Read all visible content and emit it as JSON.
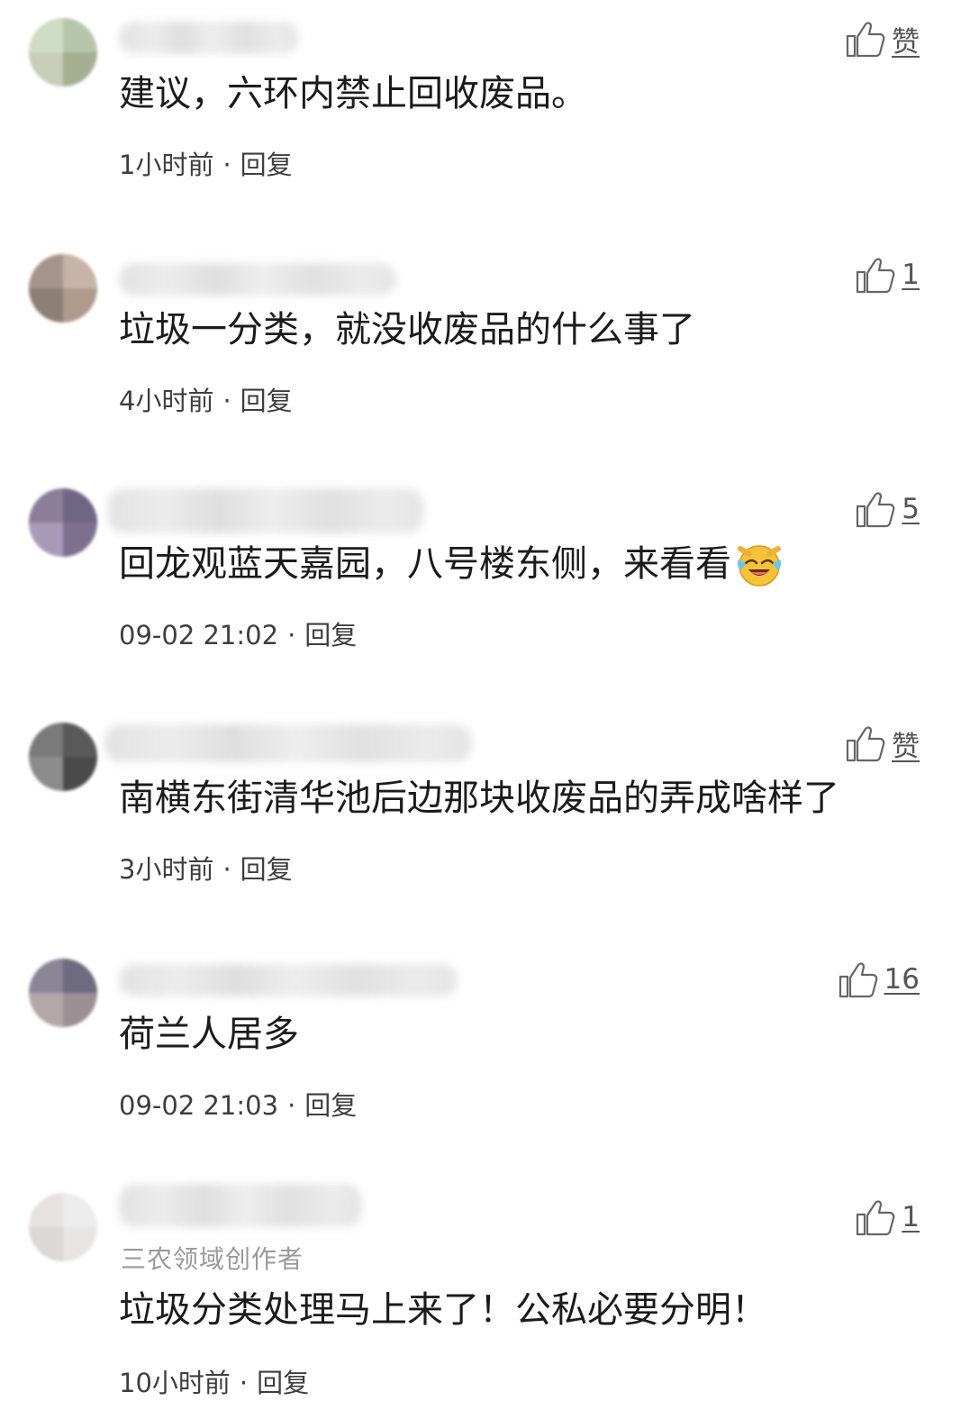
{
  "reply_label": "回复",
  "separator": "·",
  "comments": [
    {
      "avatar_colors": [
        "#cfdcc6",
        "#b7c6ab",
        "#c7cdb9",
        "#a5b092"
      ],
      "like": "赞",
      "text": "建议，六环内禁止回收废品。",
      "time": "1小时前"
    },
    {
      "avatar_colors": [
        "#a4948c",
        "#c7b3a8",
        "#8d7f76",
        "#b09a8c"
      ],
      "like": "1",
      "text": "垃圾一分类，就没收废品的什么事了",
      "time": "4小时前"
    },
    {
      "avatar_colors": [
        "#8c7f9a",
        "#6f6585",
        "#a89bb8",
        "#7d7090"
      ],
      "like": "5",
      "text": "回龙观蓝天嘉园，八号楼东侧，来看看",
      "emoji": "laughing-crying-emoji",
      "time": "09-02 21:02"
    },
    {
      "avatar_colors": [
        "#7a7a7a",
        "#5a5a5a",
        "#8c8c8c",
        "#4a4a4a"
      ],
      "like": "赞",
      "text": "南横东街清华池后边那块收废品的弄成啥样了",
      "time": "3小时前"
    },
    {
      "avatar_colors": [
        "#8a8696",
        "#6e6a80",
        "#b3a8a8",
        "#9c8f96"
      ],
      "like": "16",
      "text": "荷兰人居多",
      "time": "09-02 21:03"
    },
    {
      "avatar_colors": [
        "#e6e2e2",
        "#ededed",
        "#dcd8d8",
        "#e8e4e4"
      ],
      "like": "1",
      "author_tag": "三农领域创作者",
      "text": "垃圾分类处理马上来了！公私必要分明！",
      "time": "10小时前"
    }
  ]
}
